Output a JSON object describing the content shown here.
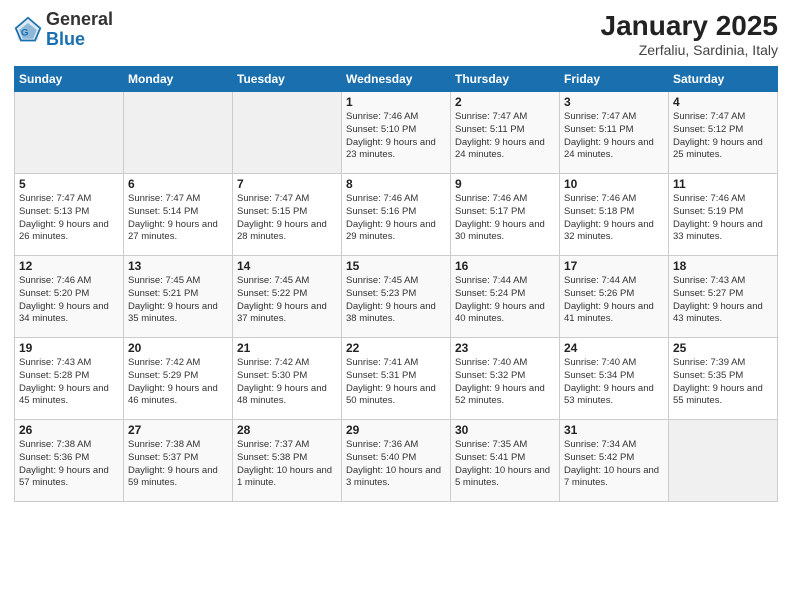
{
  "header": {
    "logo_general": "General",
    "logo_blue": "Blue",
    "month_title": "January 2025",
    "location": "Zerfaliu, Sardinia, Italy"
  },
  "weekdays": [
    "Sunday",
    "Monday",
    "Tuesday",
    "Wednesday",
    "Thursday",
    "Friday",
    "Saturday"
  ],
  "weeks": [
    [
      {
        "day": "",
        "info": ""
      },
      {
        "day": "",
        "info": ""
      },
      {
        "day": "",
        "info": ""
      },
      {
        "day": "1",
        "info": "Sunrise: 7:46 AM\nSunset: 5:10 PM\nDaylight: 9 hours and 23 minutes."
      },
      {
        "day": "2",
        "info": "Sunrise: 7:47 AM\nSunset: 5:11 PM\nDaylight: 9 hours and 24 minutes."
      },
      {
        "day": "3",
        "info": "Sunrise: 7:47 AM\nSunset: 5:11 PM\nDaylight: 9 hours and 24 minutes."
      },
      {
        "day": "4",
        "info": "Sunrise: 7:47 AM\nSunset: 5:12 PM\nDaylight: 9 hours and 25 minutes."
      }
    ],
    [
      {
        "day": "5",
        "info": "Sunrise: 7:47 AM\nSunset: 5:13 PM\nDaylight: 9 hours and 26 minutes."
      },
      {
        "day": "6",
        "info": "Sunrise: 7:47 AM\nSunset: 5:14 PM\nDaylight: 9 hours and 27 minutes."
      },
      {
        "day": "7",
        "info": "Sunrise: 7:47 AM\nSunset: 5:15 PM\nDaylight: 9 hours and 28 minutes."
      },
      {
        "day": "8",
        "info": "Sunrise: 7:46 AM\nSunset: 5:16 PM\nDaylight: 9 hours and 29 minutes."
      },
      {
        "day": "9",
        "info": "Sunrise: 7:46 AM\nSunset: 5:17 PM\nDaylight: 9 hours and 30 minutes."
      },
      {
        "day": "10",
        "info": "Sunrise: 7:46 AM\nSunset: 5:18 PM\nDaylight: 9 hours and 32 minutes."
      },
      {
        "day": "11",
        "info": "Sunrise: 7:46 AM\nSunset: 5:19 PM\nDaylight: 9 hours and 33 minutes."
      }
    ],
    [
      {
        "day": "12",
        "info": "Sunrise: 7:46 AM\nSunset: 5:20 PM\nDaylight: 9 hours and 34 minutes."
      },
      {
        "day": "13",
        "info": "Sunrise: 7:45 AM\nSunset: 5:21 PM\nDaylight: 9 hours and 35 minutes."
      },
      {
        "day": "14",
        "info": "Sunrise: 7:45 AM\nSunset: 5:22 PM\nDaylight: 9 hours and 37 minutes."
      },
      {
        "day": "15",
        "info": "Sunrise: 7:45 AM\nSunset: 5:23 PM\nDaylight: 9 hours and 38 minutes."
      },
      {
        "day": "16",
        "info": "Sunrise: 7:44 AM\nSunset: 5:24 PM\nDaylight: 9 hours and 40 minutes."
      },
      {
        "day": "17",
        "info": "Sunrise: 7:44 AM\nSunset: 5:26 PM\nDaylight: 9 hours and 41 minutes."
      },
      {
        "day": "18",
        "info": "Sunrise: 7:43 AM\nSunset: 5:27 PM\nDaylight: 9 hours and 43 minutes."
      }
    ],
    [
      {
        "day": "19",
        "info": "Sunrise: 7:43 AM\nSunset: 5:28 PM\nDaylight: 9 hours and 45 minutes."
      },
      {
        "day": "20",
        "info": "Sunrise: 7:42 AM\nSunset: 5:29 PM\nDaylight: 9 hours and 46 minutes."
      },
      {
        "day": "21",
        "info": "Sunrise: 7:42 AM\nSunset: 5:30 PM\nDaylight: 9 hours and 48 minutes."
      },
      {
        "day": "22",
        "info": "Sunrise: 7:41 AM\nSunset: 5:31 PM\nDaylight: 9 hours and 50 minutes."
      },
      {
        "day": "23",
        "info": "Sunrise: 7:40 AM\nSunset: 5:32 PM\nDaylight: 9 hours and 52 minutes."
      },
      {
        "day": "24",
        "info": "Sunrise: 7:40 AM\nSunset: 5:34 PM\nDaylight: 9 hours and 53 minutes."
      },
      {
        "day": "25",
        "info": "Sunrise: 7:39 AM\nSunset: 5:35 PM\nDaylight: 9 hours and 55 minutes."
      }
    ],
    [
      {
        "day": "26",
        "info": "Sunrise: 7:38 AM\nSunset: 5:36 PM\nDaylight: 9 hours and 57 minutes."
      },
      {
        "day": "27",
        "info": "Sunrise: 7:38 AM\nSunset: 5:37 PM\nDaylight: 9 hours and 59 minutes."
      },
      {
        "day": "28",
        "info": "Sunrise: 7:37 AM\nSunset: 5:38 PM\nDaylight: 10 hours and 1 minute."
      },
      {
        "day": "29",
        "info": "Sunrise: 7:36 AM\nSunset: 5:40 PM\nDaylight: 10 hours and 3 minutes."
      },
      {
        "day": "30",
        "info": "Sunrise: 7:35 AM\nSunset: 5:41 PM\nDaylight: 10 hours and 5 minutes."
      },
      {
        "day": "31",
        "info": "Sunrise: 7:34 AM\nSunset: 5:42 PM\nDaylight: 10 hours and 7 minutes."
      },
      {
        "day": "",
        "info": ""
      }
    ]
  ]
}
